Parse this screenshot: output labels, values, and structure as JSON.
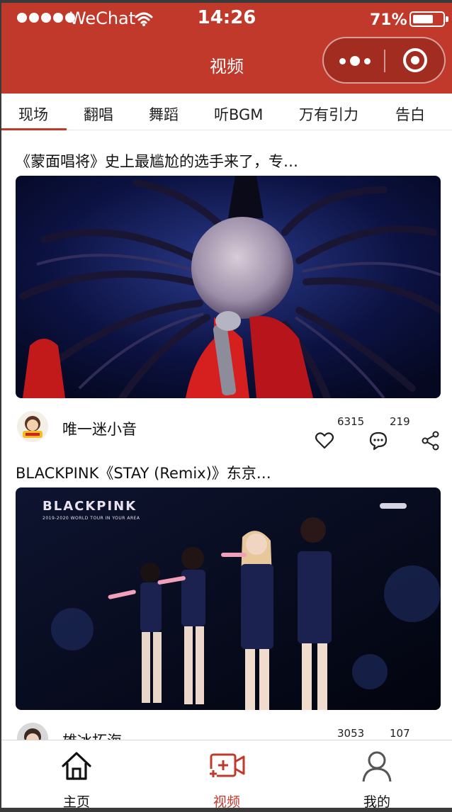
{
  "status_bar": {
    "carrier": "WeChat",
    "time": "14:26",
    "battery_percent": "71%",
    "battery_level": 0.71
  },
  "nav": {
    "title": "视频",
    "menu_icon": "more-dots-icon",
    "close_icon": "target-close-icon"
  },
  "category_tabs": [
    {
      "label": "现场",
      "active": true
    },
    {
      "label": "翻唱",
      "active": false
    },
    {
      "label": "舞蹈",
      "active": false
    },
    {
      "label": "听BGM",
      "active": false
    },
    {
      "label": "万有引力",
      "active": false
    },
    {
      "label": "告白",
      "active": false
    }
  ],
  "videos": [
    {
      "title": "《蒙面唱将》史上最尴尬的选手来了，专…",
      "author": "唯一迷小音",
      "likes": "6315",
      "comments": "219"
    },
    {
      "title": "BLACKPINK《STAY (Remix)》东京…",
      "thumbnail_logo": "BLACKPINK",
      "thumbnail_subtitle": "2019-2020 WORLD TOUR IN YOUR AREA",
      "author": "雄冰拓海",
      "likes": "3053",
      "comments": "107"
    }
  ],
  "tab_bar": [
    {
      "label": "主页",
      "icon": "home-icon",
      "active": false
    },
    {
      "label": "视频",
      "icon": "video-add-icon",
      "active": true
    },
    {
      "label": "我的",
      "icon": "person-icon",
      "active": false
    }
  ],
  "colors": {
    "brand": "#c0392b",
    "text": "#111111",
    "inactive_icon": "#222222"
  }
}
